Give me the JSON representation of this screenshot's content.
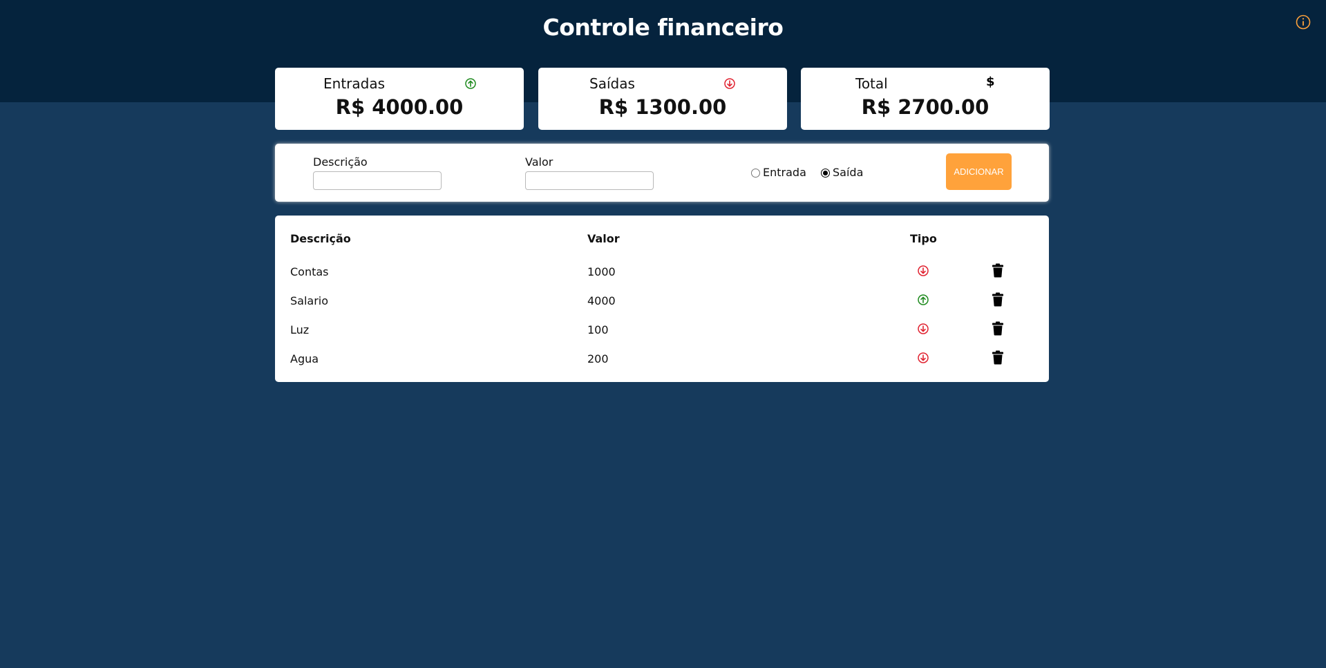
{
  "header": {
    "title": "Controle financeiro",
    "info_icon": "info-circle-icon"
  },
  "colors": {
    "header_bg": "#05233d",
    "page_bg": "#163a5c",
    "income": "#1e8a1e",
    "expense": "#e0212f",
    "accent": "#ffa23b"
  },
  "summary": {
    "income": {
      "label": "Entradas",
      "value": "R$ 4000.00",
      "icon": "arrow-up-circle-icon"
    },
    "expense": {
      "label": "Saídas",
      "value": "R$ 1300.00",
      "icon": "arrow-down-circle-icon"
    },
    "total": {
      "label": "Total",
      "value": "R$ 2700.00",
      "icon": "$"
    }
  },
  "form": {
    "description_label": "Descrição",
    "description_value": "",
    "value_label": "Valor",
    "value_value": "",
    "radio_income_label": "Entrada",
    "radio_expense_label": "Saída",
    "selected_type": "Saída",
    "add_button": "ADICIONAR"
  },
  "table": {
    "headers": {
      "description": "Descrição",
      "value": "Valor",
      "type": "Tipo"
    },
    "rows": [
      {
        "description": "Contas",
        "value": "1000",
        "type": "saida"
      },
      {
        "description": "Salario",
        "value": "4000",
        "type": "entrada"
      },
      {
        "description": "Luz",
        "value": "100",
        "type": "saida"
      },
      {
        "description": "Agua",
        "value": "200",
        "type": "saida"
      }
    ]
  }
}
